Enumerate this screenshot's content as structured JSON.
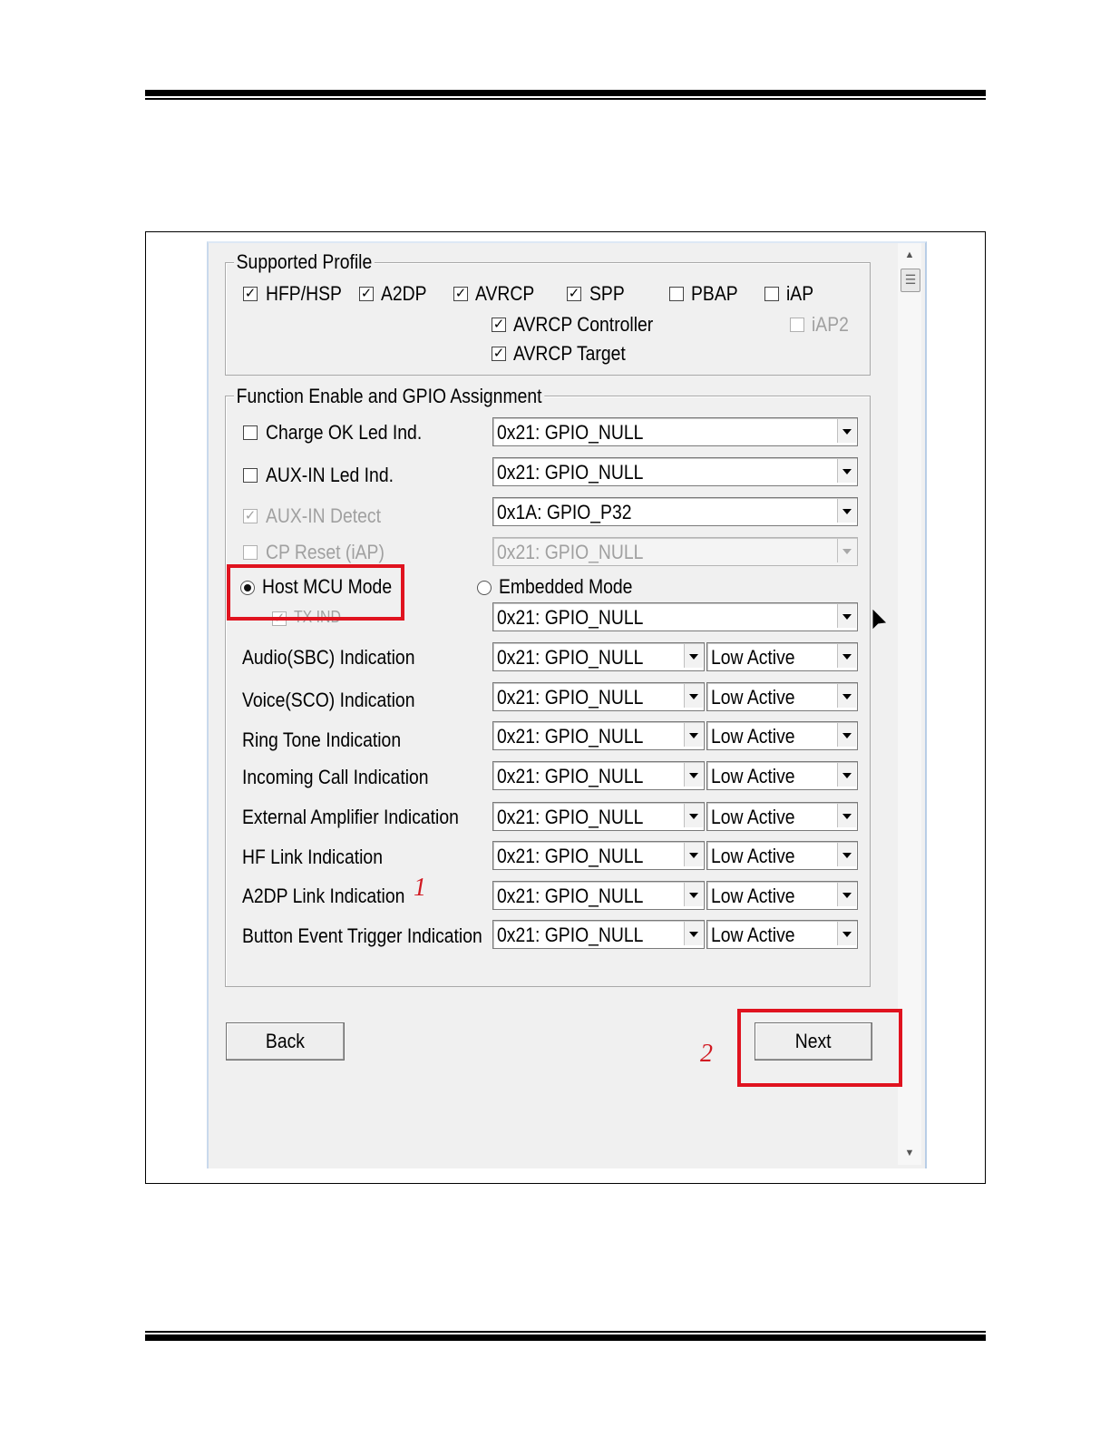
{
  "supported_profile": {
    "legend": "Supported Profile",
    "items": [
      {
        "label": "HFP/HSP",
        "checked": true
      },
      {
        "label": "A2DP",
        "checked": true
      },
      {
        "label": "AVRCP",
        "checked": true
      },
      {
        "label": "SPP",
        "checked": true
      },
      {
        "label": "PBAP",
        "checked": false
      },
      {
        "label": "iAP",
        "checked": false
      },
      {
        "label": "AVRCP Controller",
        "checked": true
      },
      {
        "label": "iAP2",
        "checked": false,
        "disabled": true
      },
      {
        "label": "AVRCP Target",
        "checked": true
      }
    ]
  },
  "function_enable": {
    "legend": "Function Enable and GPIO Assignment",
    "charge_ok": {
      "label": "Charge OK Led Ind.",
      "gpio": "0x21:  GPIO_NULL"
    },
    "aux_in_led": {
      "label": "AUX-IN Led Ind.",
      "gpio": "0x21:  GPIO_NULL"
    },
    "aux_in_detect": {
      "label": "AUX-IN Detect",
      "gpio": "0x1A:  GPIO_P32"
    },
    "cp_reset": {
      "label": "CP Reset (iAP)",
      "gpio": "0x21:  GPIO_NULL"
    },
    "host_mcu_mode": "Host MCU Mode",
    "embedded_mode": "Embedded Mode",
    "tx_ind": {
      "label": "TX IND",
      "gpio": "0x21:  GPIO_NULL"
    },
    "indications": [
      {
        "label": "Audio(SBC) Indication",
        "gpio": "0x21:  GPIO_NULL",
        "level": "Low Active"
      },
      {
        "label": "Voice(SCO) Indication",
        "gpio": "0x21:  GPIO_NULL",
        "level": "Low Active"
      },
      {
        "label": "Ring Tone Indication",
        "gpio": "0x21:  GPIO_NULL",
        "level": "Low Active"
      },
      {
        "label": "Incoming Call Indication",
        "gpio": "0x21:  GPIO_NULL",
        "level": "Low Active"
      },
      {
        "label": "External Amplifier Indication",
        "gpio": "0x21:  GPIO_NULL",
        "level": "Low Active"
      },
      {
        "label": "HF Link Indication",
        "gpio": "0x21:  GPIO_NULL",
        "level": "Low Active"
      },
      {
        "label": "A2DP Link Indication",
        "gpio": "0x21:  GPIO_NULL",
        "level": "Low Active"
      },
      {
        "label": "Button Event Trigger Indication",
        "gpio": "0x21:  GPIO_NULL",
        "level": "Low Active"
      }
    ]
  },
  "buttons": {
    "back": "Back",
    "next": "Next"
  },
  "annotations": {
    "one": "1",
    "two": "2"
  },
  "colors": {
    "highlight_red": "#e0131f",
    "annotation_red": "#d11a22",
    "panel_bg": "#f0f0f0"
  }
}
